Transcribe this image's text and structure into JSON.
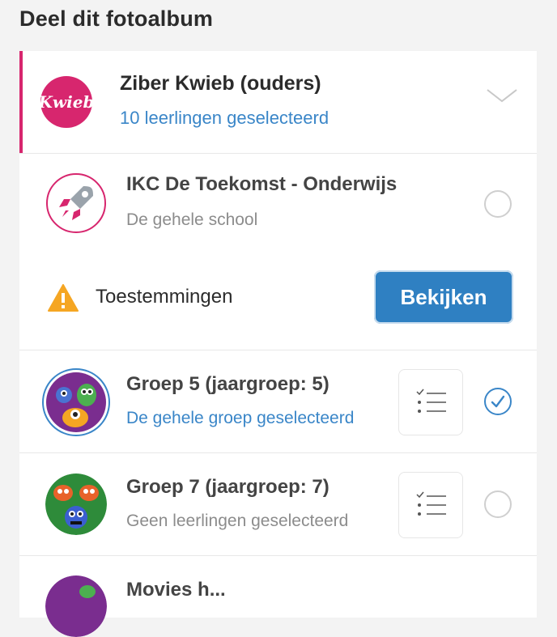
{
  "page": {
    "title": "Deel dit fotoalbum"
  },
  "organisation": {
    "logo_text": "Kwieb",
    "name": "Ziber Kwieb (ouders)",
    "selected_text": "10 leerlingen geselecteerd",
    "accent_color": "#d7266e"
  },
  "school": {
    "name": "IKC De Toekomst - Onderwijs",
    "subtitle": "De gehele school",
    "checked": false
  },
  "permissions": {
    "label": "Toestemmingen",
    "button_label": "Bekijken",
    "warning_color": "#f5a623"
  },
  "groups": [
    {
      "name": "Groep 5 (jaargroep: 5)",
      "subtitle": "De gehele groep geselecteerd",
      "checked": true
    },
    {
      "name": "Groep 7 (jaargroep: 7)",
      "subtitle": "Geen leerlingen geselecteerd",
      "checked": false
    },
    {
      "name": "Movies h...",
      "subtitle": "",
      "checked": false
    }
  ],
  "colors": {
    "primary": "#2f80c2",
    "link": "#3a86c8"
  }
}
